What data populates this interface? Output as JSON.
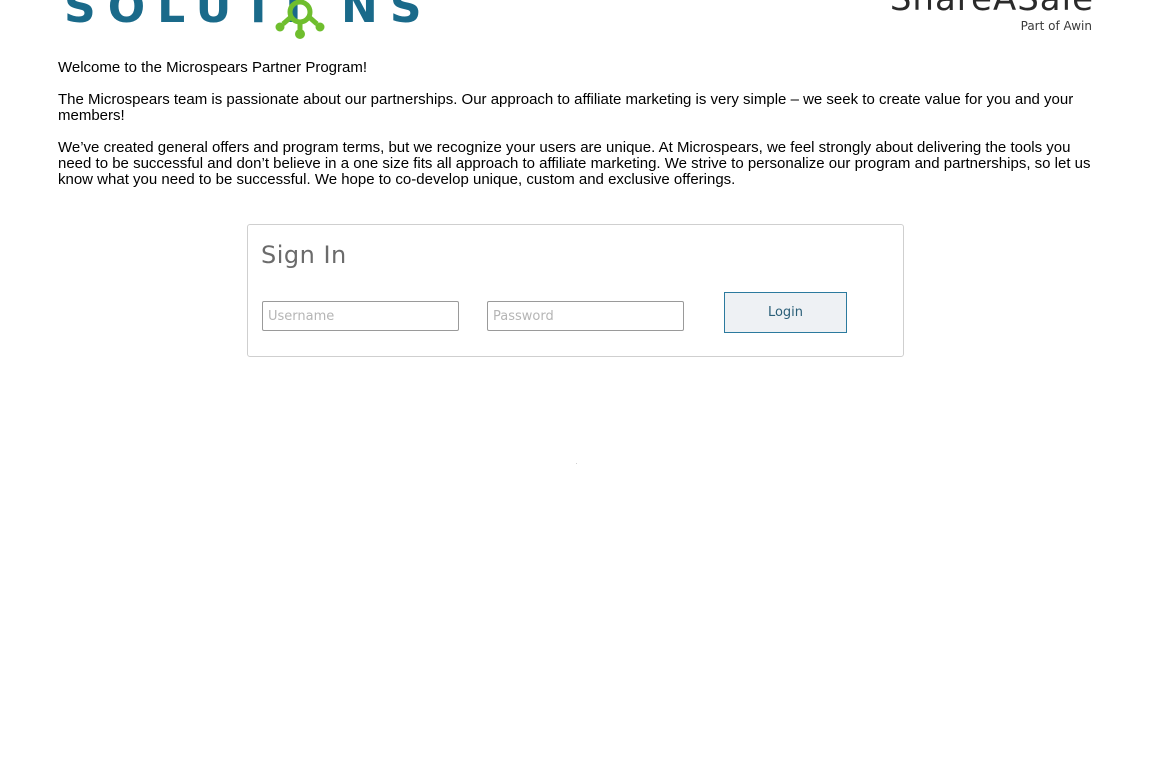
{
  "header": {
    "left_logo": {
      "letters": "SOLUTI NS",
      "accent_color": "#6fbe2e",
      "text_color": "#1a6a8a"
    },
    "right_logo": {
      "wordmark": "ShareASale",
      "tagline": "Part of Awin"
    }
  },
  "intro": {
    "welcome": "Welcome to the Microspears Partner Program!",
    "paragraph_1": "The Microspears team is passionate about our partnerships. Our approach to affiliate marketing is very simple – we seek to create value for you and your members!",
    "paragraph_2": "We’ve created general offers and program terms, but we recognize your users are unique. At Microspears, we feel strongly about delivering the tools you need to be successful and don’t believe in a one size fits all approach to affiliate marketing. We strive to personalize our program and partnerships, so let us know what you need to be successful. We hope to co-develop unique, custom and exclusive offerings."
  },
  "signin": {
    "title": "Sign In",
    "username": {
      "value": "",
      "placeholder": "Username"
    },
    "password": {
      "value": "",
      "placeholder": "Password"
    },
    "login_label": "Login"
  },
  "colors": {
    "button_border": "#2b7a9e",
    "button_text": "#2a5f78",
    "card_border": "#cfcfcf"
  }
}
